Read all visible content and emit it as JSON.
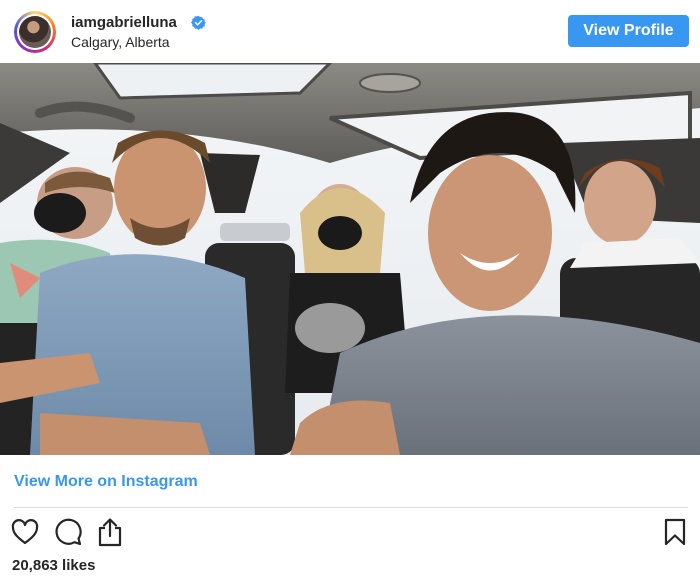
{
  "header": {
    "username": "iamgabrielluna",
    "location": "Calgary, Alberta",
    "view_profile_label": "View Profile",
    "verified": true
  },
  "photo": {
    "description_icon": "group-selfie-photo"
  },
  "footer": {
    "view_more_label": "View More on Instagram",
    "likes": "20,863 likes"
  },
  "icons": [
    "heart-icon",
    "comment-icon",
    "share-icon",
    "bookmark-icon",
    "verified-badge-icon"
  ],
  "colors": {
    "link_blue": "#3897f0",
    "button_blue": "#3897f0",
    "text": "#262626",
    "divider": "#dbdbdb"
  }
}
